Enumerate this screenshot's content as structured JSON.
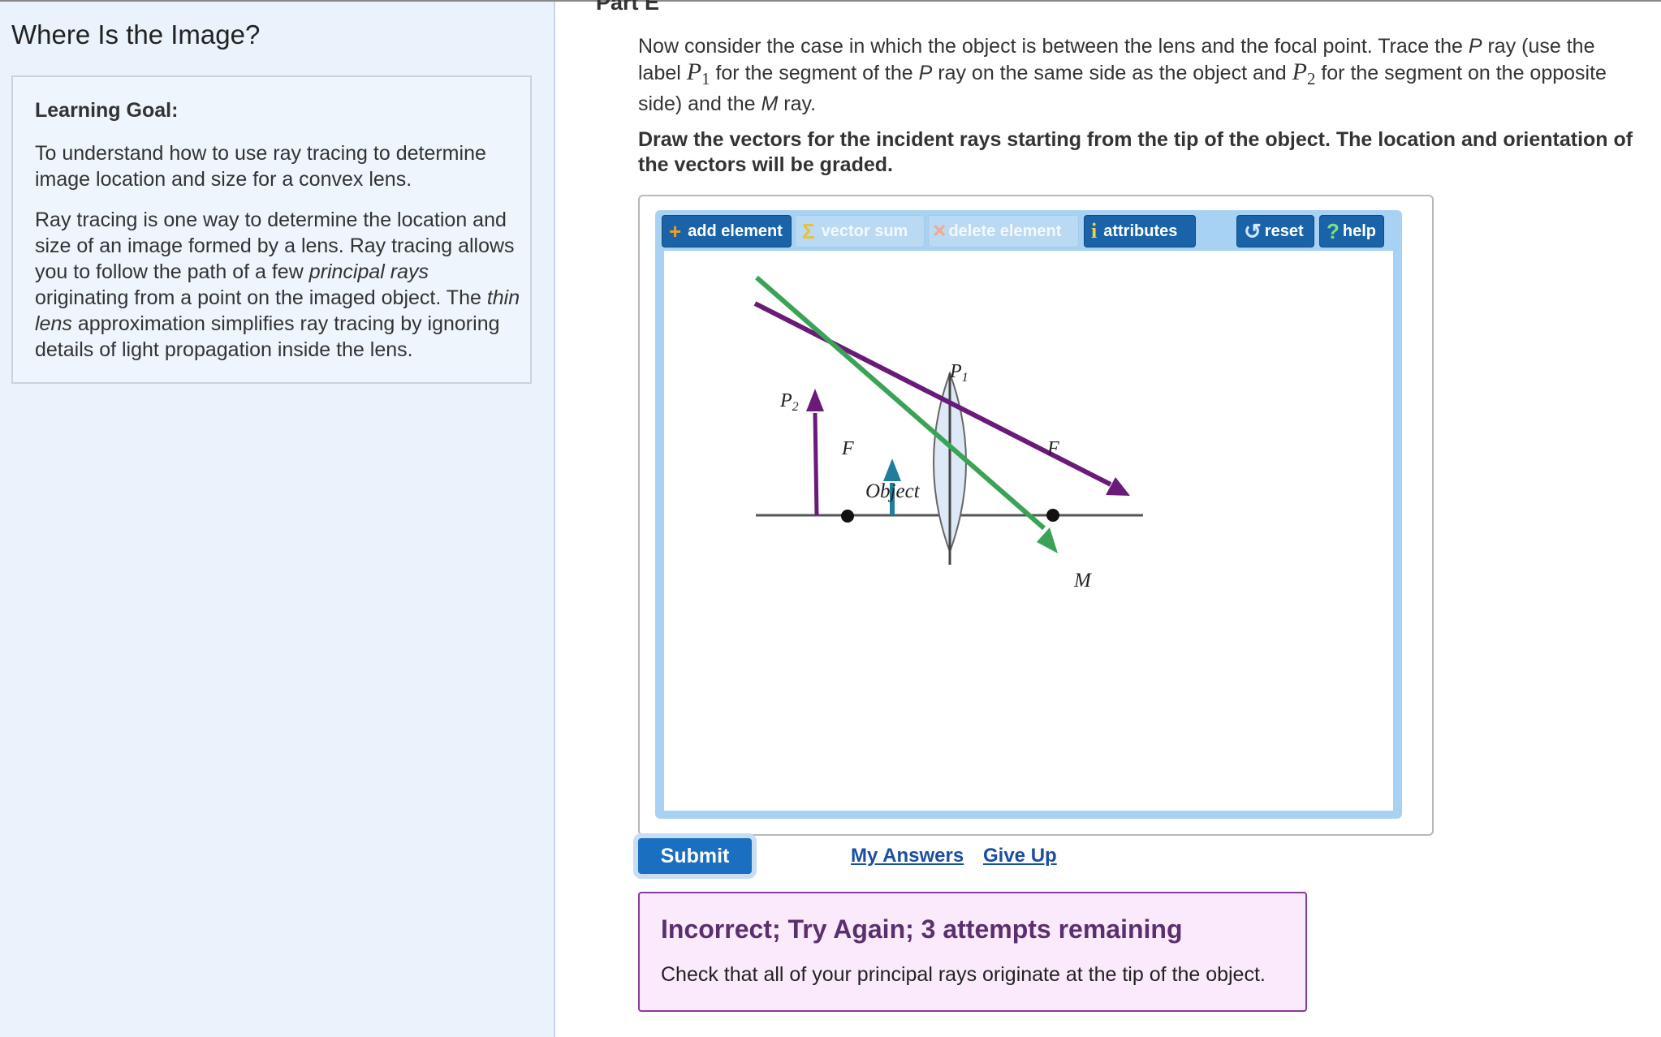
{
  "left": {
    "title": "Where Is the Image?",
    "goal_heading": "Learning Goal:",
    "goal_paragraph": "To understand how to use ray tracing to determine image location and size for a convex lens.",
    "ray_p1": "Ray tracing is one way to determine the location and size of an image formed by a lens. Ray tracing allows you to follow the path of a few ",
    "ray_em1": "principal rays",
    "ray_p2": " originating from a point on the imaged object. The ",
    "ray_em2": "thin lens",
    "ray_p3": " approximation simplifies ray tracing by ignoring details of light propagation inside the lens."
  },
  "part": {
    "title": "Part E",
    "instr_a": "Now consider the case in which the object is between the lens and the focal point. Trace the ",
    "instr_p": "P",
    "instr_b": " ray (use the label ",
    "instr_p1": "P",
    "instr_sub1": "1",
    "instr_c": " for the segment of the ",
    "instr_p_again": "P",
    "instr_d": " ray on the same side as the object and ",
    "instr_p2": "P",
    "instr_sub2": "2",
    "instr_e": " for the segment on the opposite side) and the ",
    "instr_m": "M",
    "instr_f": " ray.",
    "instruction_bold": "Draw the vectors for the incident rays starting from the tip of the object. The location and orientation of the vectors will be graded."
  },
  "toolbar": {
    "add_element": "add element",
    "vector_sum": "vector sum",
    "delete_element": "delete element",
    "attributes": "attributes",
    "reset": "reset",
    "help": "help",
    "plus_glyph": "+",
    "sigma_glyph": "Σ",
    "x_glyph": "✕",
    "info_glyph": "i",
    "reset_glyph": "↺",
    "help_glyph": "?"
  },
  "diagram": {
    "label_p1": "P",
    "label_p1_sub": "1",
    "label_p2": "P",
    "label_p2_sub": "2",
    "label_f_left": "F",
    "label_f_right": "F",
    "label_object": "Object",
    "label_m": "M",
    "colors": {
      "p_ray": "#6a1b7a",
      "m_ray": "#3aa356",
      "object": "#1f7f9a",
      "axis": "#555555"
    }
  },
  "actions": {
    "submit": "Submit",
    "my_answers": "My Answers",
    "give_up": "Give Up"
  },
  "feedback": {
    "title": "Incorrect; Try Again; 3 attempts remaining",
    "message": "Check that all of your principal rays originate at the tip of the object."
  }
}
